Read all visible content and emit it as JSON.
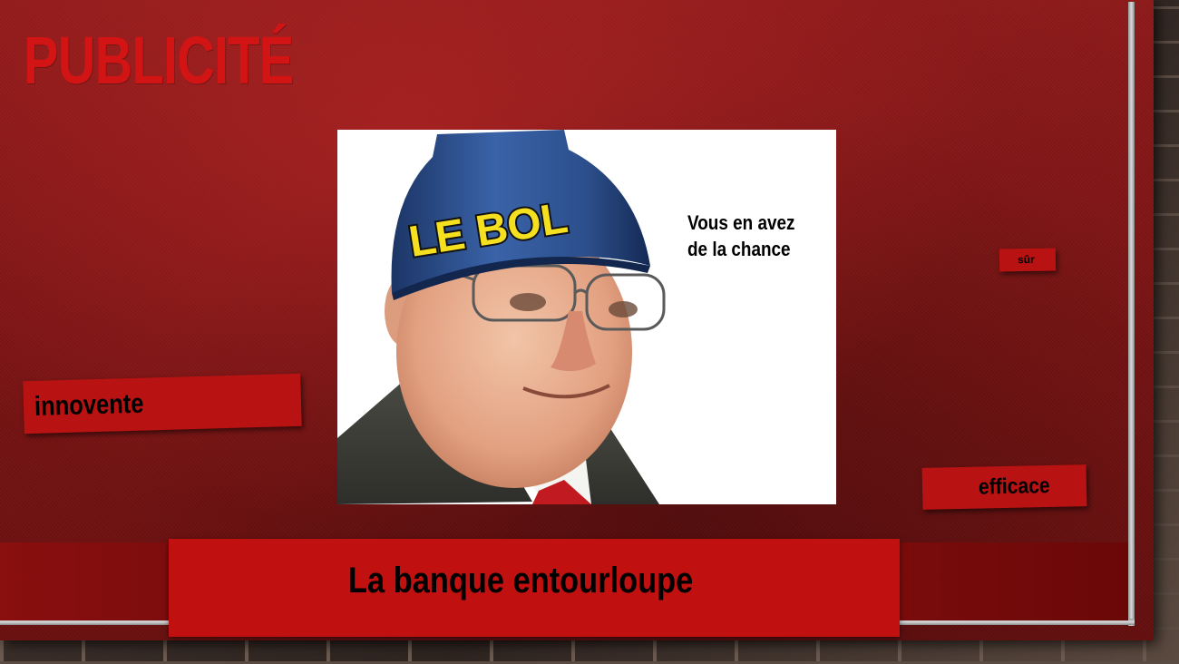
{
  "slide": {
    "title": "PUBLICITÉ",
    "ad": {
      "brand": "LE BOL",
      "tagline_line1": "Vous en avez",
      "tagline_line2": "de la chance"
    },
    "tags": {
      "innovente": "innovente",
      "sur": "sûr",
      "efficace": "efficace"
    },
    "slogan": "La banque entourloupe"
  },
  "colors": {
    "slide_bg": "#7a1414",
    "title": "#d21414",
    "tag_bg": "#b81212",
    "slogan_bg": "#c01010",
    "brand_text": "#f5e020",
    "bowl": "#2c4f8c"
  }
}
